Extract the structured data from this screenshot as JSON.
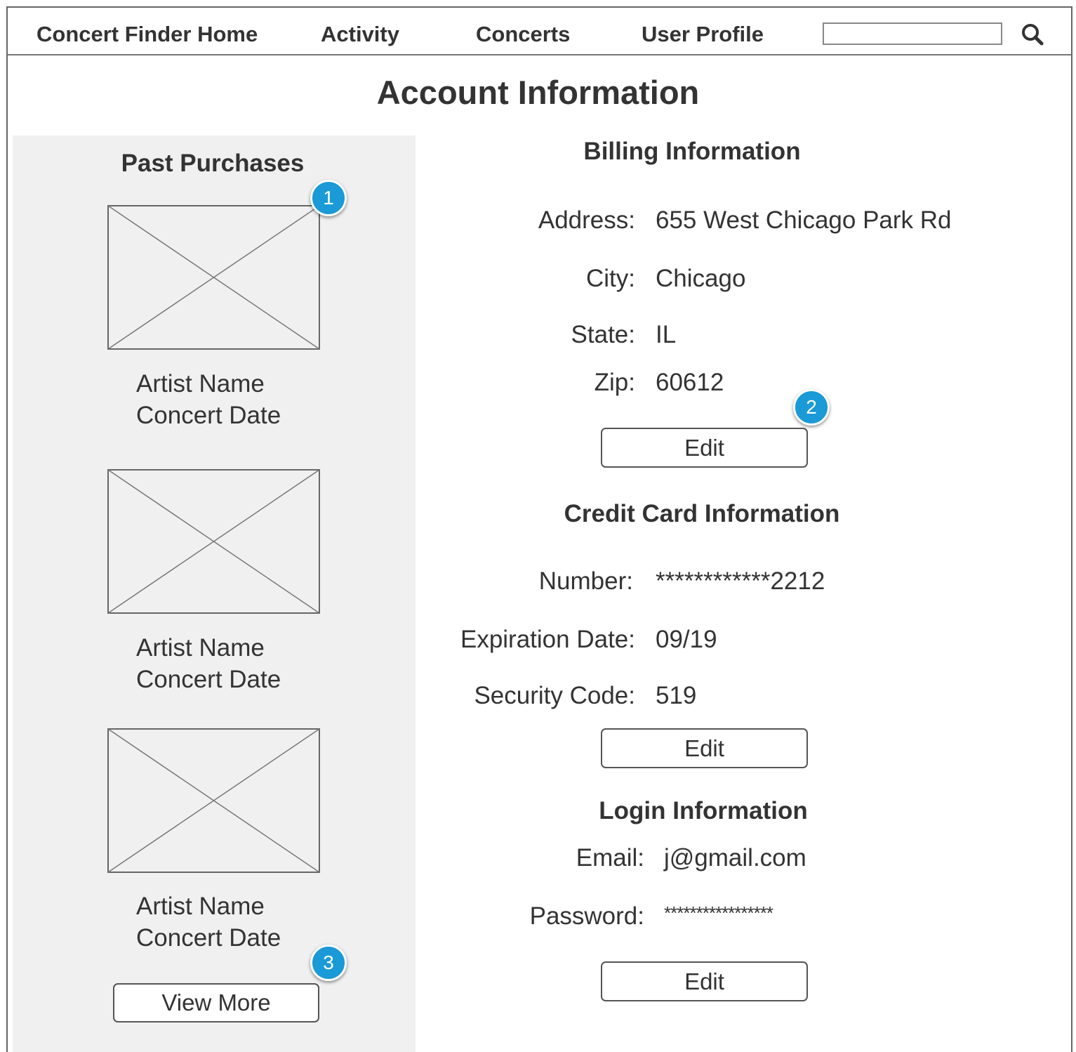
{
  "nav": {
    "home": "Concert Finder Home",
    "activity": "Activity",
    "concerts": "Concerts",
    "user_profile": "User Profile",
    "search_value": ""
  },
  "page": {
    "title": "Account Information"
  },
  "past_purchases": {
    "title": "Past Purchases",
    "items": [
      {
        "artist": "Artist Name",
        "date": "Concert Date"
      },
      {
        "artist": "Artist Name",
        "date": "Concert Date"
      },
      {
        "artist": "Artist Name",
        "date": "Concert Date"
      }
    ],
    "view_more_label": "View More"
  },
  "billing": {
    "title": "Billing Information",
    "address_label": "Address:",
    "address": "655 West Chicago Park Rd",
    "city_label": "City:",
    "city": "Chicago",
    "state_label": "State:",
    "state": "IL",
    "zip_label": "Zip:",
    "zip": "60612",
    "edit_label": "Edit"
  },
  "credit_card": {
    "title": "Credit Card Information",
    "number_label": "Number:",
    "number": "************2212",
    "expiration_label": "Expiration Date:",
    "expiration": "09/19",
    "security_label": "Security Code:",
    "security": "519",
    "edit_label": "Edit"
  },
  "login": {
    "title": "Login Information",
    "email_label": "Email:",
    "email": "j@gmail.com",
    "password_label": "Password:",
    "password": "*****************",
    "edit_label": "Edit"
  },
  "callouts": [
    "1",
    "2",
    "3"
  ],
  "colors": {
    "callout": "#1a9ad6",
    "sidebar_bg": "#f0f0f0",
    "border": "#666666"
  }
}
